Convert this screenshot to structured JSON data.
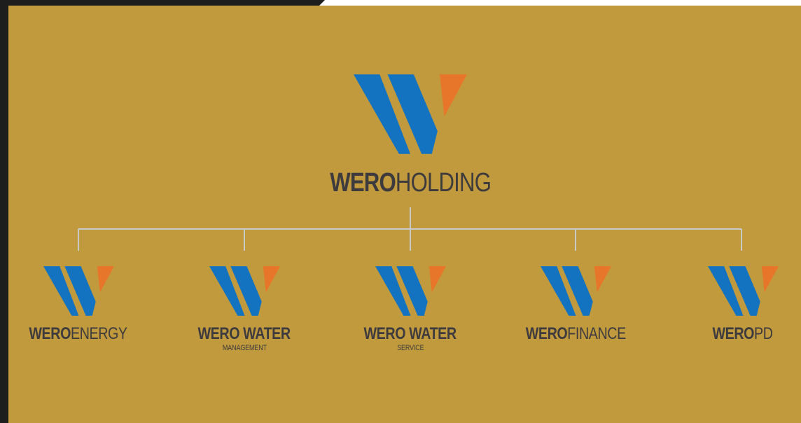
{
  "colors": {
    "background": "#c19a3d",
    "frame": "#1d1d1d",
    "logo_blue": "#1373c0",
    "logo_orange": "#e8762a",
    "text": "#3d3b3d",
    "connector": "#c9c9c9"
  },
  "root": {
    "brand_bold": "WERO",
    "brand_light": "HOLDING",
    "icon": "wero-w-logo-icon"
  },
  "children": [
    {
      "brand_bold": "WERO",
      "brand_light": "ENERGY",
      "sub": ""
    },
    {
      "brand_bold": "WERO WATER",
      "brand_light": "",
      "sub": "MANAGEMENT"
    },
    {
      "brand_bold": "WERO WATER",
      "brand_light": "",
      "sub": "SERVICE"
    },
    {
      "brand_bold": "WERO",
      "brand_light": "FINANCE",
      "sub": ""
    },
    {
      "brand_bold": "WERO",
      "brand_light": "PD",
      "sub": ""
    }
  ]
}
